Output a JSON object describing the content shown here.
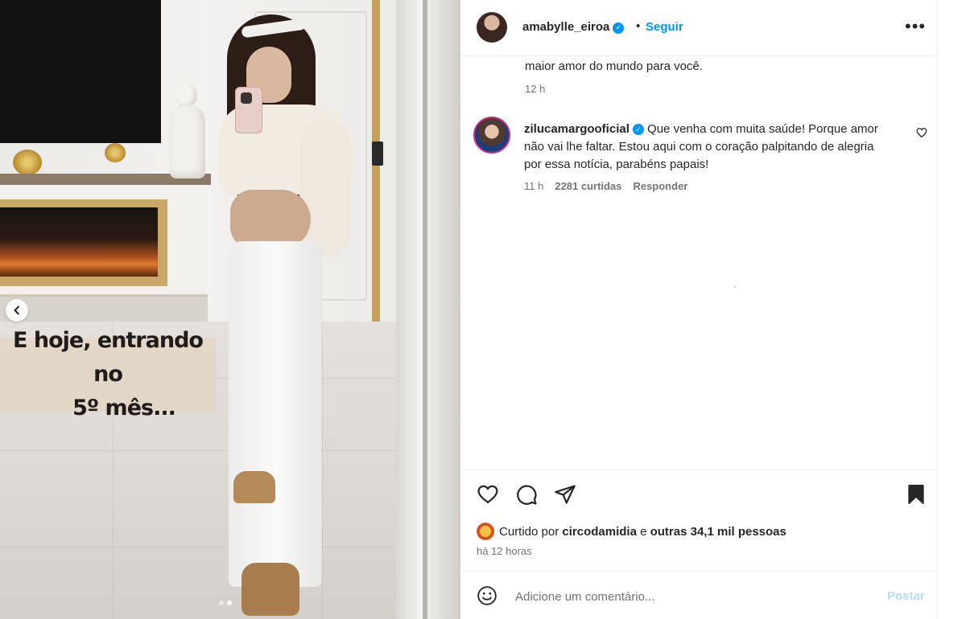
{
  "post": {
    "caption_line1": "E hoje, entrando no",
    "caption_line2": "5º mês...",
    "carousel_dots": 2,
    "active_dot": 2
  },
  "header": {
    "username": "amabylle_eiroa",
    "separator": "•",
    "follow_label": "Seguir",
    "more_label": "•••",
    "verified": true
  },
  "previous_comment": {
    "text_tail": "maior amor do mundo para você.",
    "time": "12 h"
  },
  "comment": {
    "username": "zilucamargooficial",
    "verified": true,
    "text": "Que venha com muita saúde! Porque amor não vai lhe faltar. Estou aqui com o coração palpitando de alegria por essa notícia, parabéns papais!",
    "time": "11 h",
    "likes": "2281 curtidas",
    "reply_label": "Responder"
  },
  "actions": {
    "icons": [
      "heart-icon",
      "comment-icon",
      "share-icon",
      "bookmark-icon"
    ]
  },
  "likes": {
    "prefix": "Curtido por",
    "liker": "circodamidia",
    "connector": "e",
    "others": "outras 34,1 mil pessoas"
  },
  "time_ago": "há 12 horas",
  "add_comment": {
    "placeholder": "Adicione um comentário...",
    "post_label": "Postar"
  },
  "colors": {
    "accent": "#0095f6",
    "post_disabled": "#b3dbff",
    "secondary_text": "#737373"
  }
}
